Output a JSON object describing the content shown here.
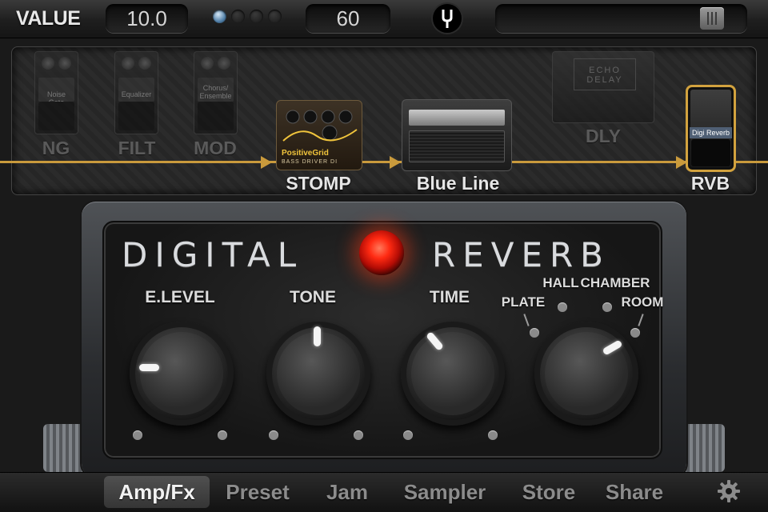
{
  "topbar": {
    "value_label": "VALUE",
    "value_display": "10.0",
    "bpm_display": "60",
    "tempo_dots": 4,
    "tempo_active_index": 0,
    "tuner_icon": "tuning-fork-icon",
    "master_slider_level": 0.88
  },
  "signal_chain": {
    "line_color": "#c99a3c",
    "modules": [
      {
        "id": "ng",
        "label": "NG",
        "active": false,
        "pedal_text": "Noise Gate"
      },
      {
        "id": "filt",
        "label": "FILT",
        "active": false,
        "pedal_text": "Equalizer"
      },
      {
        "id": "mod",
        "label": "MOD",
        "active": false,
        "pedal_text": "Chorus/ Ensemble"
      },
      {
        "id": "stomp",
        "label": "STOMP",
        "active": true,
        "pedal_text": "PositiveGrid",
        "pedal_subtext": "BASS DRIVER DI"
      },
      {
        "id": "amp",
        "label": "Blue Line",
        "active": true
      },
      {
        "id": "dly",
        "label": "DLY",
        "active": false,
        "pedal_text": "ECHO DELAY"
      },
      {
        "id": "rvb",
        "label": "RVB",
        "active": true,
        "selected": true,
        "pedal_text": "Digi Reverb"
      }
    ]
  },
  "pedal": {
    "title_left": "DIGITAL",
    "title_right": "REVERB",
    "led_color": "#ff2a12",
    "knobs": [
      {
        "label": "E.LEVEL",
        "value": 0.0
      },
      {
        "label": "TONE",
        "value": 0.5
      },
      {
        "label": "TIME",
        "value": 0.38
      }
    ],
    "mode_selector": {
      "options": [
        "PLATE",
        "HALL",
        "CHAMBER",
        "ROOM"
      ],
      "selected": "ROOM"
    }
  },
  "nav": {
    "items": [
      {
        "label": "Amp/Fx",
        "active": true
      },
      {
        "label": "Preset",
        "active": false
      },
      {
        "label": "Jam",
        "active": false
      },
      {
        "label": "Sampler",
        "active": false
      },
      {
        "label": "Store",
        "active": false
      },
      {
        "label": "Share",
        "active": false
      }
    ],
    "settings_icon": "gear-icon"
  }
}
